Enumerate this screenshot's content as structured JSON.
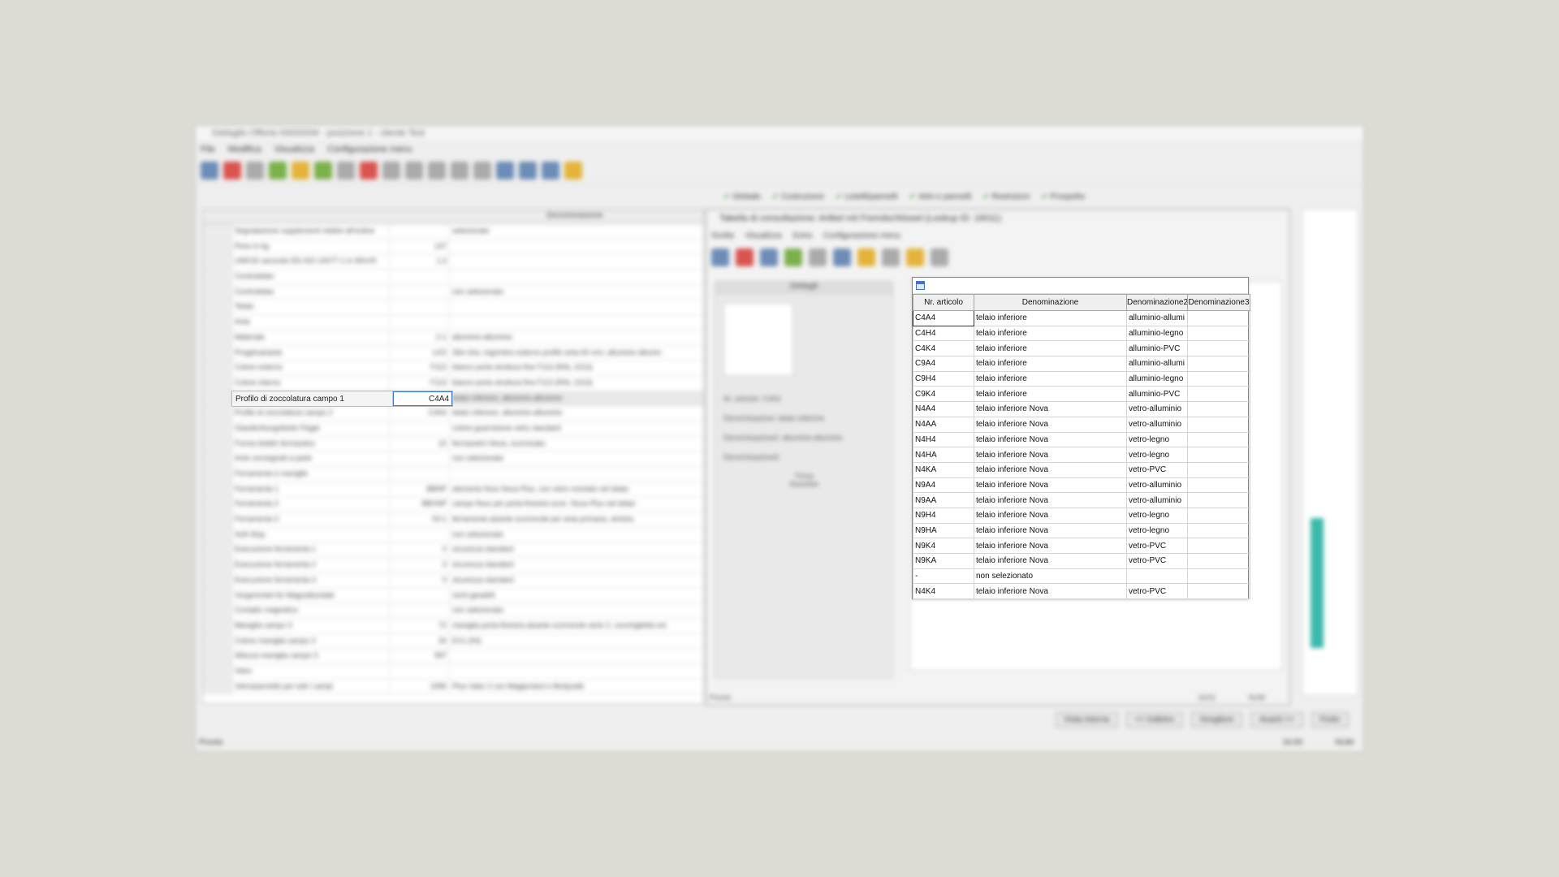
{
  "background_app": {
    "title": "Dettaglio Offerta 00000006 - posizione 1 - cliente Test",
    "menu": [
      "File",
      "Modifica",
      "Visualizza",
      "Configurazione menu"
    ],
    "tabs": [
      "Globale",
      "Costruzione",
      "Listelli/pannelli",
      "Vetri e pannelli",
      "Restrizioni",
      "Prospetto"
    ],
    "grid_header": "Denominazione",
    "grid_rows": [
      {
        "label": "Segnalazione supplementi relativi all'ordine",
        "value": "",
        "desc": "selezionato"
      },
      {
        "label": "Peso in kg",
        "value": "147",
        "desc": ""
      },
      {
        "label": "UW/UD secondo EN ISO 10077-1 in W/m²K",
        "value": "1,3",
        "desc": ""
      },
      {
        "label": "Controtelaio",
        "value": "",
        "desc": ""
      },
      {
        "label": "Controtelaio",
        "value": "",
        "desc": "non selezionato"
      },
      {
        "label": "Telaio",
        "value": "",
        "desc": ""
      },
      {
        "label": "Anta",
        "value": "",
        "desc": ""
      },
      {
        "label": "Materiale",
        "value": "2-1",
        "desc": "alluminio-alluminio"
      },
      {
        "label": "Progetvariante",
        "value": "LKS",
        "desc": "Slim line, ingombro esterno profilo anta 60 mm; alluminio allumin"
      },
      {
        "label": "Colore esterno",
        "value": "F113",
        "desc": "bianco porta struttura fine F113 (RAL 1013)"
      },
      {
        "label": "Colore interno",
        "value": "F113",
        "desc": "bianco porta struttura fine F113 (RAL 1013)"
      },
      {
        "label": "Profilo di zoccolatura campo 1",
        "value": "C4A4",
        "desc": "telaio inferiore, alluminio-alluminio"
      },
      {
        "label": "Profilo di zoccolatura campo 2",
        "value": "C4A4",
        "desc": "telaio inferiore, alluminio-alluminio"
      },
      {
        "label": "Glasdichtungsfarbe Flügel",
        "value": "",
        "desc": "colore guarnizione vetro standard"
      },
      {
        "label": "Forma listello fermavetro",
        "value": "10",
        "desc": "fermavetro Nova, scorniciato"
      },
      {
        "label": "Ante consegnati a parte",
        "value": "",
        "desc": "non selezionato"
      },
      {
        "label": "Ferramenta e maniglie",
        "value": "",
        "desc": ""
      },
      {
        "label": "Ferramenta 1",
        "value": "BBNP",
        "desc": "elemento fisso Nova Plus, con vetro montato nel telaio"
      },
      {
        "label": "Ferramenta 2",
        "value": "BBVNP",
        "desc": "campo fisso per porta-finestra scorr. Nova Plus nel telaio"
      },
      {
        "label": "Ferramenta 3",
        "value": "03-1",
        "desc": "ferramenta alzante scorrevole per anta primaria, sinistra"
      },
      {
        "label": "Soft-Stop",
        "value": "",
        "desc": "non selezionato"
      },
      {
        "label": "Esecuzione ferramenta 1",
        "value": "0",
        "desc": "sicurezza standard"
      },
      {
        "label": "Esecuzione ferramenta 2",
        "value": "0",
        "desc": "sicurezza standard"
      },
      {
        "label": "Esecuzione ferramenta 3",
        "value": "0",
        "desc": "sicurezza standard"
      },
      {
        "label": "Vorgerichtet für Magnetkontakt",
        "value": "",
        "desc": "nicht gewählt"
      },
      {
        "label": "Contatto magnetico",
        "value": "",
        "desc": "non selezionato"
      },
      {
        "label": "Maniglia campo 3",
        "value": "72",
        "desc": "maniglia porta-finestra alzante scorrevole serie 2, conchiglietta est"
      },
      {
        "label": "Colore maniglia campo 3",
        "value": "34",
        "desc": "EV1 (04)"
      },
      {
        "label": "Altezza maniglia campo 3",
        "value": "997",
        "desc": ""
      },
      {
        "label": "Vetro",
        "value": "",
        "desc": ""
      },
      {
        "label": "Vetro/pannello per tutti i campi",
        "value": "2396",
        "desc": "Plus-Valor 2 con Magiprotect e Bodysafe"
      }
    ],
    "lookup_window": {
      "title": "Tabella di consultazione: Artikel mit Fremdschlüssel (Lookup ID: 16011)",
      "menu": [
        "Scelta",
        "Visualizza",
        "Extra",
        "Configurazione menu"
      ],
      "panel_header": "Dettagli",
      "details": [
        "Nr. articolo: C4A4",
        "Denominazione: telaio inferiore",
        "Denominazione2: alluminio-alluminio",
        "Denominazione3:"
      ],
      "sections": [
        "Trova",
        "Assortire"
      ],
      "status": "Pronto",
      "status_right": [
        "16/21",
        "NUM"
      ]
    },
    "bottom_buttons": [
      "Vista interna",
      "<< Indietro",
      "Scegliere",
      "Avanti >>",
      "Finito"
    ],
    "status": "Pronto",
    "status_right": [
      "16:00",
      "NUM"
    ]
  },
  "selected_row": {
    "label": "Profilo di zoccolatura campo 1",
    "value": "C4A4"
  },
  "dropdown": {
    "columns": [
      "Nr. articolo",
      "Denominazione",
      "Denominazione2",
      "Denominazione3"
    ],
    "rows": [
      [
        "C4A4",
        "telaio inferiore",
        "alluminio-allumi",
        ""
      ],
      [
        "C4H4",
        "telaio inferiore",
        "alluminio-legno",
        ""
      ],
      [
        "C4K4",
        "telaio inferiore",
        "alluminio-PVC",
        ""
      ],
      [
        "C9A4",
        "telaio inferiore",
        "alluminio-allumi",
        ""
      ],
      [
        "C9H4",
        "telaio inferiore",
        "alluminio-legno",
        ""
      ],
      [
        "C9K4",
        "telaio inferiore",
        "alluminio-PVC",
        ""
      ],
      [
        "N4A4",
        "telaio inferiore Nova",
        "vetro-alluminio",
        ""
      ],
      [
        "N4AA",
        "telaio inferiore Nova",
        "vetro-alluminio",
        ""
      ],
      [
        "N4H4",
        "telaio inferiore Nova",
        "vetro-legno",
        ""
      ],
      [
        "N4HA",
        "telaio inferiore Nova",
        "vetro-legno",
        ""
      ],
      [
        "N4KA",
        "telaio inferiore Nova",
        "vetro-PVC",
        ""
      ],
      [
        "N9A4",
        "telaio inferiore Nova",
        "vetro-alluminio",
        ""
      ],
      [
        "N9AA",
        "telaio inferiore Nova",
        "vetro-alluminio",
        ""
      ],
      [
        "N9H4",
        "telaio inferiore Nova",
        "vetro-legno",
        ""
      ],
      [
        "N9HA",
        "telaio inferiore Nova",
        "vetro-legno",
        ""
      ],
      [
        "N9K4",
        "telaio inferiore Nova",
        "vetro-PVC",
        ""
      ],
      [
        "N9KA",
        "telaio inferiore Nova",
        "vetro-PVC",
        ""
      ],
      [
        "-",
        "non selezionato",
        "",
        ""
      ],
      [
        "N4K4",
        "telaio inferiore Nova",
        "vetro-PVC",
        ""
      ]
    ]
  }
}
